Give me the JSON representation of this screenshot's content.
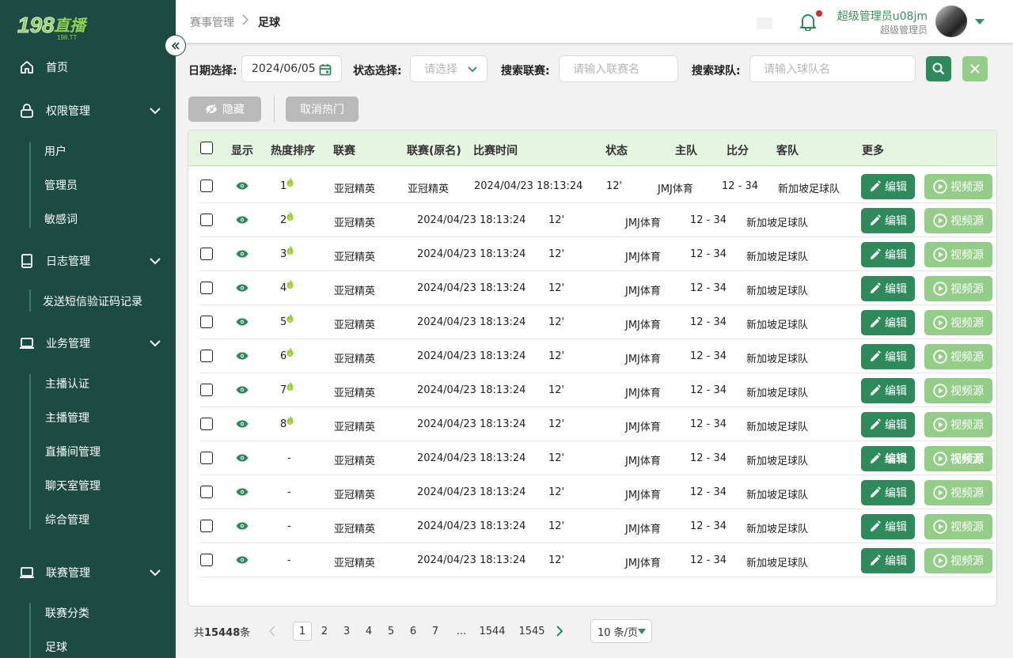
{
  "brand": {
    "logo_main": "198直播",
    "logo_sub": "198.TT"
  },
  "sidebar": {
    "home": "首页",
    "permission": {
      "label": "权限管理",
      "items": [
        "用户",
        "管理员",
        "敏感词"
      ]
    },
    "log": {
      "label": "日志管理",
      "items": [
        "发送短信验证码记录"
      ]
    },
    "business": {
      "label": "业务管理",
      "items": [
        "主播认证",
        "主播管理",
        "直播间管理",
        "聊天室管理",
        "综合管理"
      ]
    },
    "league": {
      "label": "联赛管理",
      "items": [
        "联赛分类",
        "足球"
      ]
    }
  },
  "header": {
    "breadcrumb": [
      "赛事管理",
      "足球"
    ],
    "user_name": "超级管理员u08jm",
    "user_role": "超级管理员"
  },
  "filters": {
    "date_label": "日期选择:",
    "date_value": "2024/06/05",
    "status_label": "状态选择:",
    "status_placeholder": "请选择",
    "league_label": "搜索联赛:",
    "league_placeholder": "请输入联赛名",
    "team_label": "搜索球队:",
    "team_placeholder": "请输入球队名"
  },
  "actions": {
    "hide": "隐藏",
    "cancel_hot": "取消热门"
  },
  "table": {
    "columns": [
      "显示",
      "热度排序",
      "联赛",
      "联赛(原名)",
      "比赛时间",
      "状态",
      "主队",
      "比分",
      "客队",
      "更多"
    ],
    "edit_label": "编辑",
    "video_label": "视频源",
    "rows": [
      {
        "rank": "1",
        "league": "亚冠精英",
        "league_orig": "亚冠精英",
        "date": "2024/04/23",
        "time": "18:13:24",
        "status": "12'",
        "home": "JMJ体育",
        "score": "12 - 34",
        "away": "新加坡足球队"
      },
      {
        "rank": "2",
        "league": "亚冠精英",
        "league_orig": "",
        "date": "2024/04/23",
        "time": "18:13:24",
        "status": "12'",
        "home": "JMJ体育",
        "score": "12 - 34",
        "away": "新加坡足球队"
      },
      {
        "rank": "3",
        "league": "亚冠精英",
        "league_orig": "",
        "date": "2024/04/23",
        "time": "18:13:24",
        "status": "12'",
        "home": "JMJ体育",
        "score": "12 - 34",
        "away": "新加坡足球队"
      },
      {
        "rank": "4",
        "league": "亚冠精英",
        "league_orig": "",
        "date": "2024/04/23",
        "time": "18:13:24",
        "status": "12'",
        "home": "JMJ体育",
        "score": "12 - 34",
        "away": "新加坡足球队"
      },
      {
        "rank": "5",
        "league": "亚冠精英",
        "league_orig": "",
        "date": "2024/04/23",
        "time": "18:13:24",
        "status": "12'",
        "home": "JMJ体育",
        "score": "12 - 34",
        "away": "新加坡足球队"
      },
      {
        "rank": "6",
        "league": "亚冠精英",
        "league_orig": "",
        "date": "2024/04/23",
        "time": "18:13:24",
        "status": "12'",
        "home": "JMJ体育",
        "score": "12 - 34",
        "away": "新加坡足球队"
      },
      {
        "rank": "7",
        "league": "亚冠精英",
        "league_orig": "",
        "date": "2024/04/23",
        "time": "18:13:24",
        "status": "12'",
        "home": "JMJ体育",
        "score": "12 - 34",
        "away": "新加坡足球队"
      },
      {
        "rank": "8",
        "league": "亚冠精英",
        "league_orig": "",
        "date": "2024/04/23",
        "time": "18:13:24",
        "status": "12'",
        "home": "JMJ体育",
        "score": "12 - 34",
        "away": "新加坡足球队"
      },
      {
        "rank": "-",
        "league": "亚冠精英",
        "league_orig": "",
        "date": "2024/04/23",
        "time": "18:13:24",
        "status": "12'",
        "home": "JMJ体育",
        "score": "12 - 34",
        "away": "新加坡足球队"
      },
      {
        "rank": "-",
        "league": "亚冠精英",
        "league_orig": "",
        "date": "2024/04/23",
        "time": "18:13:24",
        "status": "12'",
        "home": "JMJ体育",
        "score": "12 - 34",
        "away": "新加坡足球队"
      },
      {
        "rank": "-",
        "league": "亚冠精英",
        "league_orig": "",
        "date": "2024/04/23",
        "time": "18:13:24",
        "status": "12'",
        "home": "JMJ体育",
        "score": "12 - 34",
        "away": "新加坡足球队"
      },
      {
        "rank": "-",
        "league": "亚冠精英",
        "league_orig": "",
        "date": "2024/04/23",
        "time": "18:13:24",
        "status": "12'",
        "home": "JMJ体育",
        "score": "12 - 34",
        "away": "新加坡足球队"
      }
    ]
  },
  "pagination": {
    "total_prefix": "共",
    "total": "15448",
    "total_suffix": "条",
    "pages": [
      "1",
      "2",
      "3",
      "4",
      "5",
      "6",
      "7",
      "...",
      "1544",
      "1545"
    ],
    "page_size": "10 条/页"
  },
  "colors": {
    "sidebar": "#1b4b43",
    "primary": "#2f8a5b",
    "video": "#93cd87",
    "header_row": "#e6f4e2"
  }
}
